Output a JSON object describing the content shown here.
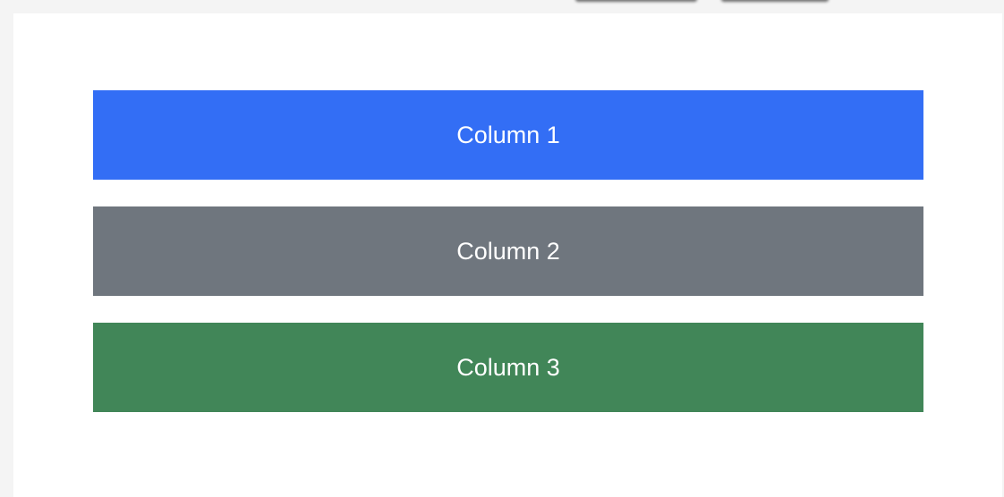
{
  "columns": [
    {
      "label": "Column 1",
      "color": "#336ef5"
    },
    {
      "label": "Column 2",
      "color": "#6f767e"
    },
    {
      "label": "Column 3",
      "color": "#418658"
    }
  ]
}
